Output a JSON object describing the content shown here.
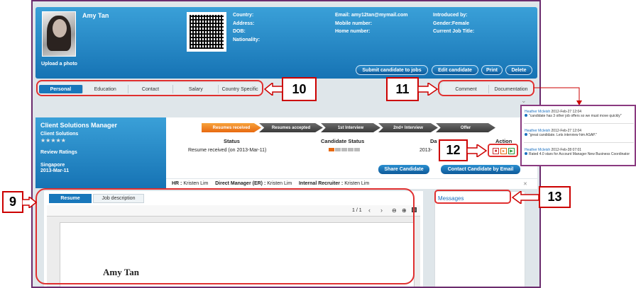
{
  "profile": {
    "name": "Amy Tan",
    "upload_label": "Upload a photo",
    "col1": [
      "Country:",
      "Address:",
      "DOB:",
      "Nationality:"
    ],
    "col2": [
      "Email: amy12tan@mymail.com",
      "Mobile number:",
      "Home number:"
    ],
    "col3": [
      "Introduced by:",
      "Gender:Female",
      "Current Job Title:"
    ]
  },
  "header_buttons": {
    "submit": "Submit candidate to jobs",
    "edit": "Edit candidate",
    "print": "Print",
    "delete": "Delete"
  },
  "tabs_left": [
    "Personal",
    "Education",
    "Contact",
    "Salary",
    "Country Specific"
  ],
  "tabs_right": [
    "Comment",
    "Documentation"
  ],
  "callouts": {
    "c9": "9",
    "c10": "10",
    "c11": "11",
    "c12": "12",
    "c13": "13"
  },
  "job": {
    "title": "Client Solutions Manager",
    "department": "Client Solutions",
    "stars": "★★★★★",
    "review_label": "Review Ratings",
    "location": "Singapore",
    "date": "2013-Mar-11"
  },
  "pipeline": [
    "Resumes received",
    "Resumes accepted",
    "1st Interview",
    "2nd+ Interview",
    "Offer"
  ],
  "status_table": {
    "status_header": "Status",
    "candidate_status_header": "Candidate Status",
    "date_header": "Da",
    "action_header": "Action",
    "status_value": "Resume received (on 2013-Mar-11)",
    "date_value": "2013-"
  },
  "actions": {
    "share": "Share Candidate",
    "contact": "Contact Candidate by Email"
  },
  "recruiters": {
    "hr_label": "HR :",
    "hr_name": "Kristen Lim",
    "dm_label": "Direct Manager (ER) :",
    "dm_name": "Kristen Lim",
    "ir_label": "Internal Recruiter :",
    "ir_name": "Kristen Lim"
  },
  "doc_tabs": {
    "resume": "Resume",
    "jd": "Job description"
  },
  "viewer": {
    "page_count": "1 / 1",
    "doc_name": "Amy Tan"
  },
  "messages": {
    "title": "Messages"
  },
  "popup_comments": [
    {
      "who": "Heather Mcleish",
      "when": "2012-Feb-27 12:04",
      "text": "\"candidate has 3 other job offers so we must move quickly\""
    },
    {
      "who": "Heather Mcleish",
      "when": "2012-Feb-27 12:04",
      "text": "\"great candidate. Lets interview him ASAP.\""
    },
    {
      "who": "Heather Mcleish",
      "when": "2012-Feb-28 07:01",
      "text": "Rated 4.0 stars for Account Manager New Business Coordinator"
    }
  ],
  "colors": {
    "accent": "#1877bb",
    "callout_border": "#cc0000",
    "frame": "#6b2c6e"
  }
}
